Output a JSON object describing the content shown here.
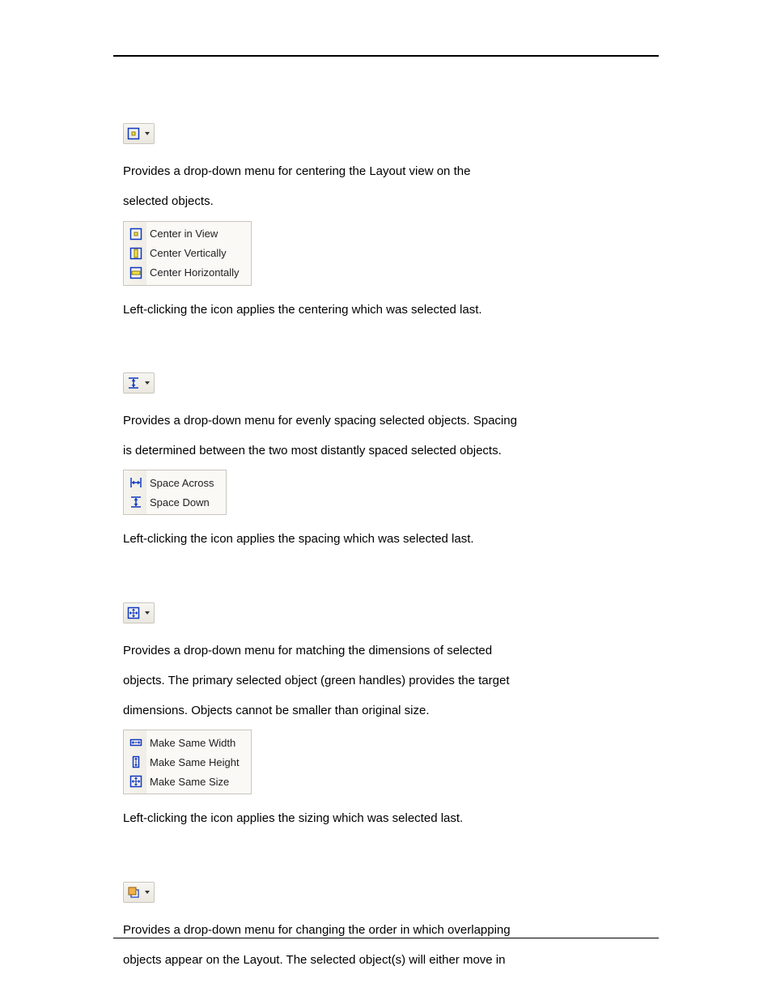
{
  "sections": {
    "center": {
      "intro1": "Provides a drop-down menu for centering the Layout view on the",
      "intro2": "selected objects.",
      "menu": [
        "Center in View",
        "Center Vertically",
        "Center Horizontally"
      ],
      "note": "Left-clicking the icon applies the centering which was selected last."
    },
    "space": {
      "intro1": "Provides a drop-down menu for evenly spacing selected objects. Spacing",
      "intro2": "is determined between the two most distantly spaced selected objects.",
      "menu": [
        "Space Across",
        "Space Down"
      ],
      "note": "Left-clicking the icon applies the spacing which was selected last."
    },
    "size": {
      "intro1": "Provides a drop-down menu for matching the dimensions of selected",
      "intro2": "objects. The primary selected object (green handles) provides the target",
      "intro3": "dimensions. Objects cannot be smaller than original size.",
      "menu": [
        "Make Same Width",
        "Make Same Height",
        "Make Same Size"
      ],
      "note": "Left-clicking the icon applies the sizing which was selected last."
    },
    "order": {
      "intro1": "Provides a drop-down menu for changing the order in which overlapping",
      "intro2": "objects appear on the Layout. The selected object(s) will either move in"
    }
  }
}
